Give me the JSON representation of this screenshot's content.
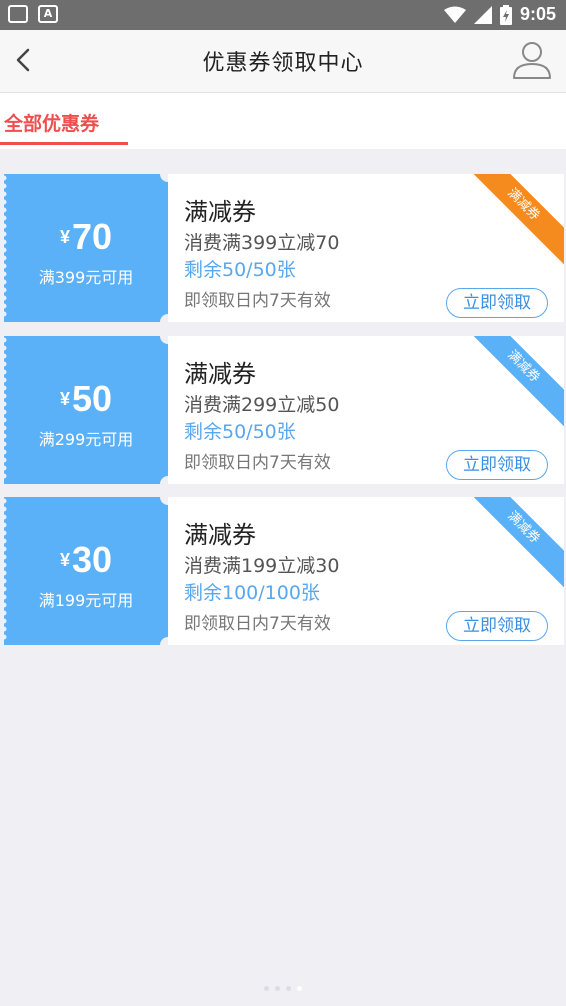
{
  "status_bar": {
    "time": "9:05",
    "icons": [
      "inbox-icon",
      "font-icon",
      "wifi-icon",
      "signal-icon",
      "battery-icon"
    ],
    "font_icon_letter": "A"
  },
  "header": {
    "title": "优惠券领取中心",
    "back_icon": "chevron-left-icon",
    "user_icon": "user-icon"
  },
  "tabs": [
    {
      "label": "全部优惠券",
      "active": true
    }
  ],
  "colors": {
    "accent_red": "#ef4f4f",
    "coupon_blue": "#5bb1f8",
    "ribbon_orange": "#f58a1f",
    "ribbon_blue": "#5bb1f8"
  },
  "coupons": [
    {
      "currency": "¥",
      "amount": "70",
      "condition": "满399元可用",
      "name": "满减券",
      "description": "消费满399立减70",
      "remaining": "剩余50/50张",
      "validity": "即领取日内7天有效",
      "button": "立即领取",
      "ribbon": "满减券",
      "ribbon_color": "#f58a1f"
    },
    {
      "currency": "¥",
      "amount": "50",
      "condition": "满299元可用",
      "name": "满减券",
      "description": "消费满299立减50",
      "remaining": "剩余50/50张",
      "validity": "即领取日内7天有效",
      "button": "立即领取",
      "ribbon": "满减券",
      "ribbon_color": "#5bb1f8"
    },
    {
      "currency": "¥",
      "amount": "30",
      "condition": "满199元可用",
      "name": "满减券",
      "description": "消费满199立减30",
      "remaining": "剩余100/100张",
      "validity": "即领取日内7天有效",
      "button": "立即领取",
      "ribbon": "满减券",
      "ribbon_color": "#5bb1f8"
    }
  ],
  "pager": {
    "count": 4,
    "active_index": 3
  }
}
